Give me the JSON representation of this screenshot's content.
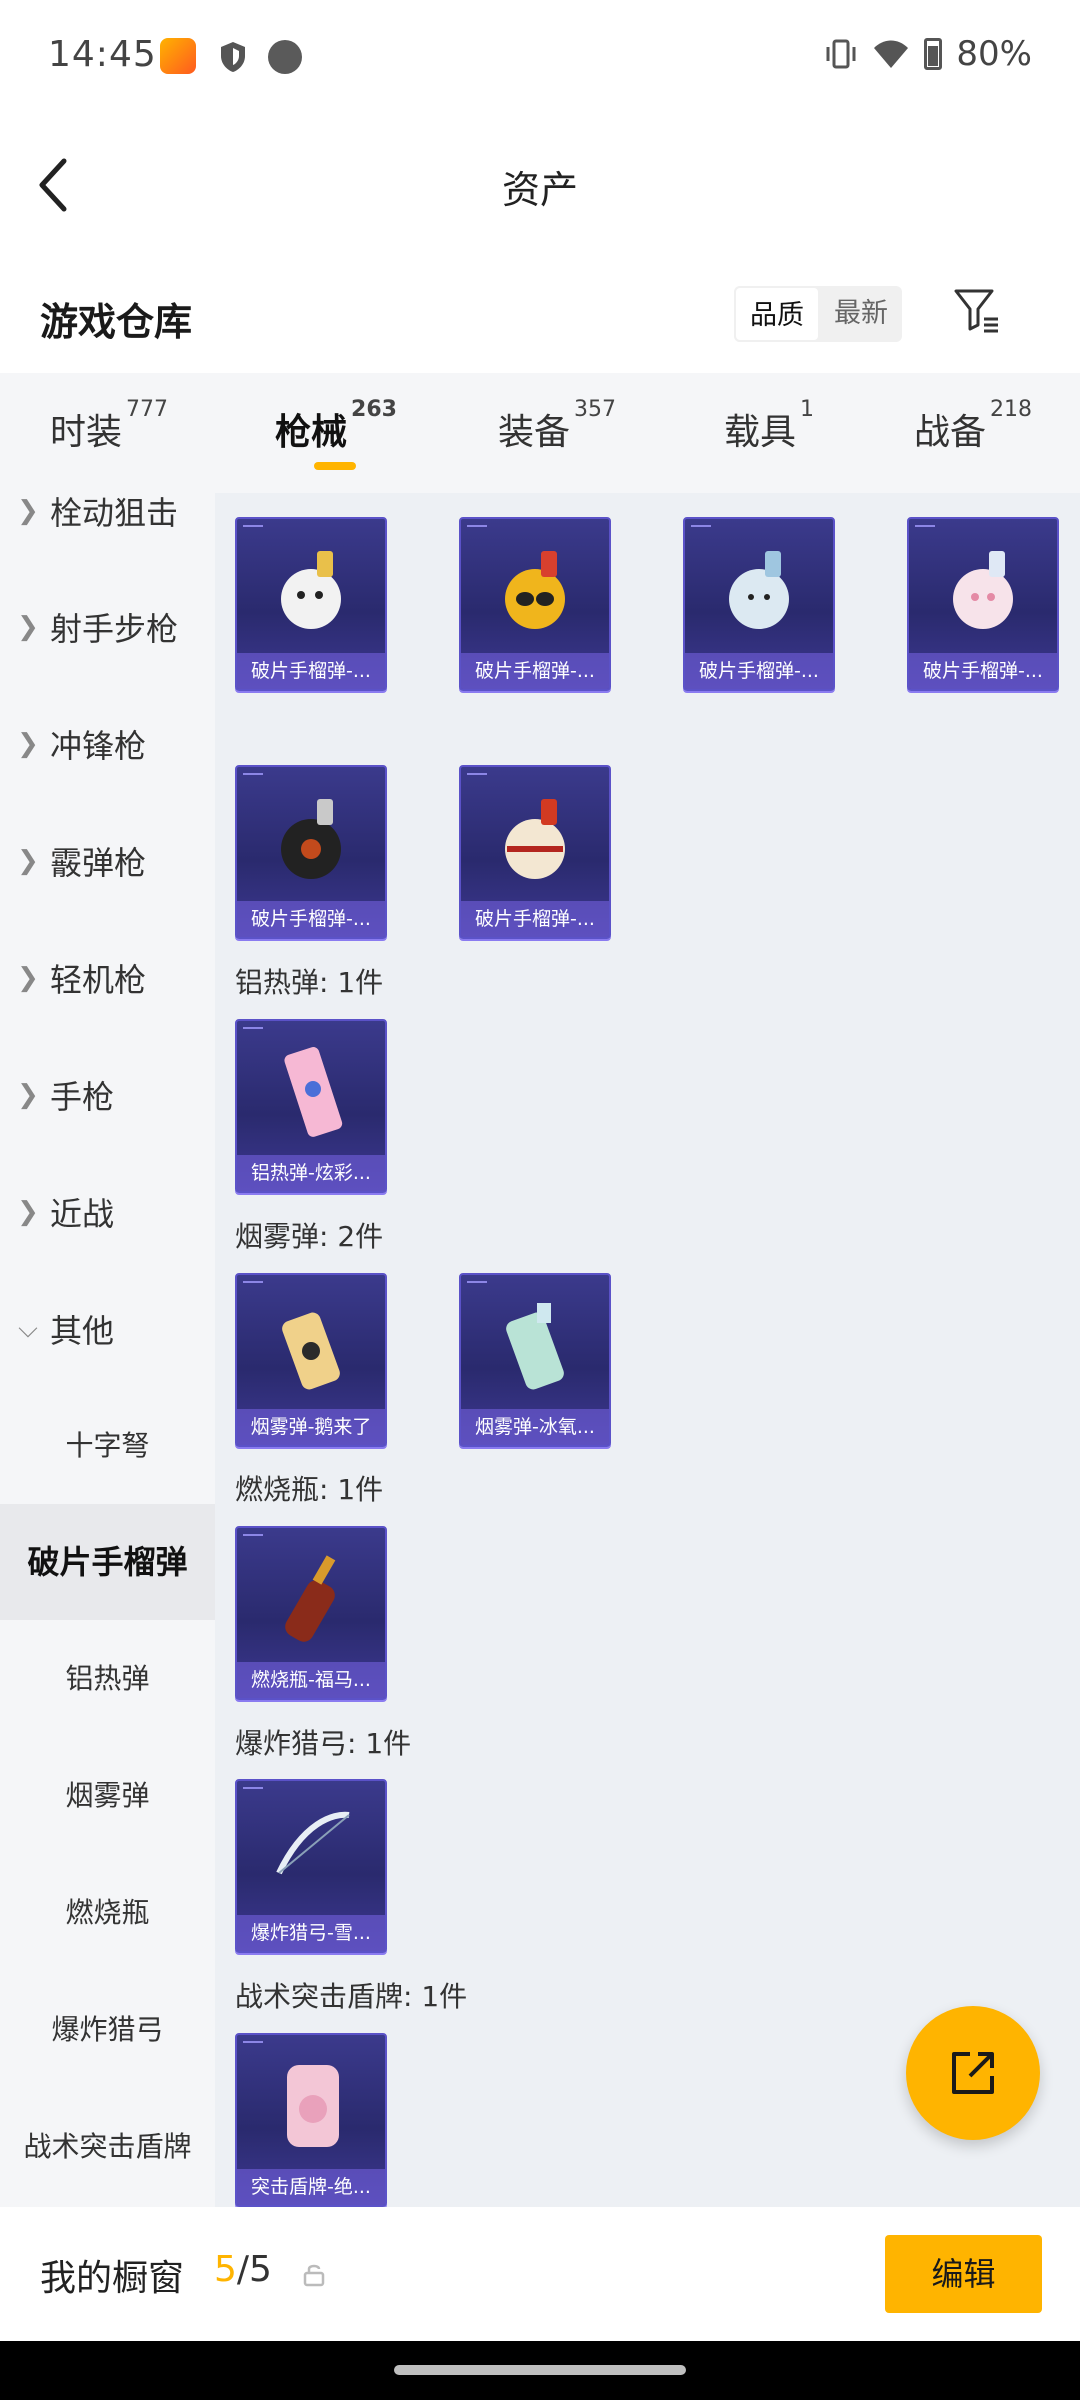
{
  "status_bar": {
    "time": "14:45",
    "battery": "80%"
  },
  "header": {
    "title": "资产"
  },
  "section": {
    "title": "游戏仓库",
    "sort_options": [
      "品质",
      "最新"
    ],
    "sort_selected": "品质"
  },
  "tabs": [
    {
      "label": "时装",
      "count": "777"
    },
    {
      "label": "枪械",
      "count": "263"
    },
    {
      "label": "装备",
      "count": "357"
    },
    {
      "label": "载具",
      "count": "1"
    },
    {
      "label": "战备",
      "count": "218"
    }
  ],
  "sidebar": {
    "categories": [
      {
        "label": "栓动狙击",
        "expanded": false
      },
      {
        "label": "射手步枪",
        "expanded": false
      },
      {
        "label": "冲锋枪",
        "expanded": false
      },
      {
        "label": "霰弹枪",
        "expanded": false
      },
      {
        "label": "轻机枪",
        "expanded": false
      },
      {
        "label": "手枪",
        "expanded": false
      },
      {
        "label": "近战",
        "expanded": false
      },
      {
        "label": "其他",
        "expanded": true
      }
    ],
    "subcategories": [
      "十字弩",
      "破片手榴弹",
      "铝热弹",
      "烟雾弹",
      "燃烧瓶",
      "爆炸猎弓",
      "战术突击盾牌"
    ],
    "selected": "破片手榴弹"
  },
  "groups": [
    {
      "title": "",
      "items": [
        "破片手榴弹-...",
        "破片手榴弹-...",
        "破片手榴弹-...",
        "破片手榴弹-...",
        "破片手榴弹-...",
        "破片手榴弹-..."
      ]
    },
    {
      "title": "铝热弹: 1件",
      "items": [
        "铝热弹-炫彩..."
      ]
    },
    {
      "title": "烟雾弹: 2件",
      "items": [
        "烟雾弹-鹅来了",
        "烟雾弹-冰氧..."
      ]
    },
    {
      "title": "燃烧瓶: 1件",
      "items": [
        "燃烧瓶-福马..."
      ]
    },
    {
      "title": "爆炸猎弓: 1件",
      "items": [
        "爆炸猎弓-雪..."
      ]
    },
    {
      "title": "战术突击盾牌: 1件",
      "items": [
        "突击盾牌-绝..."
      ]
    }
  ],
  "bottom_bar": {
    "label": "我的橱窗",
    "count_current": "5",
    "count_sep": "/",
    "count_total": "5",
    "edit_label": "编辑"
  },
  "colors": {
    "accent": "#ffb400",
    "card_bg": "#2f2d76",
    "content_bg": "#edf0f4"
  }
}
